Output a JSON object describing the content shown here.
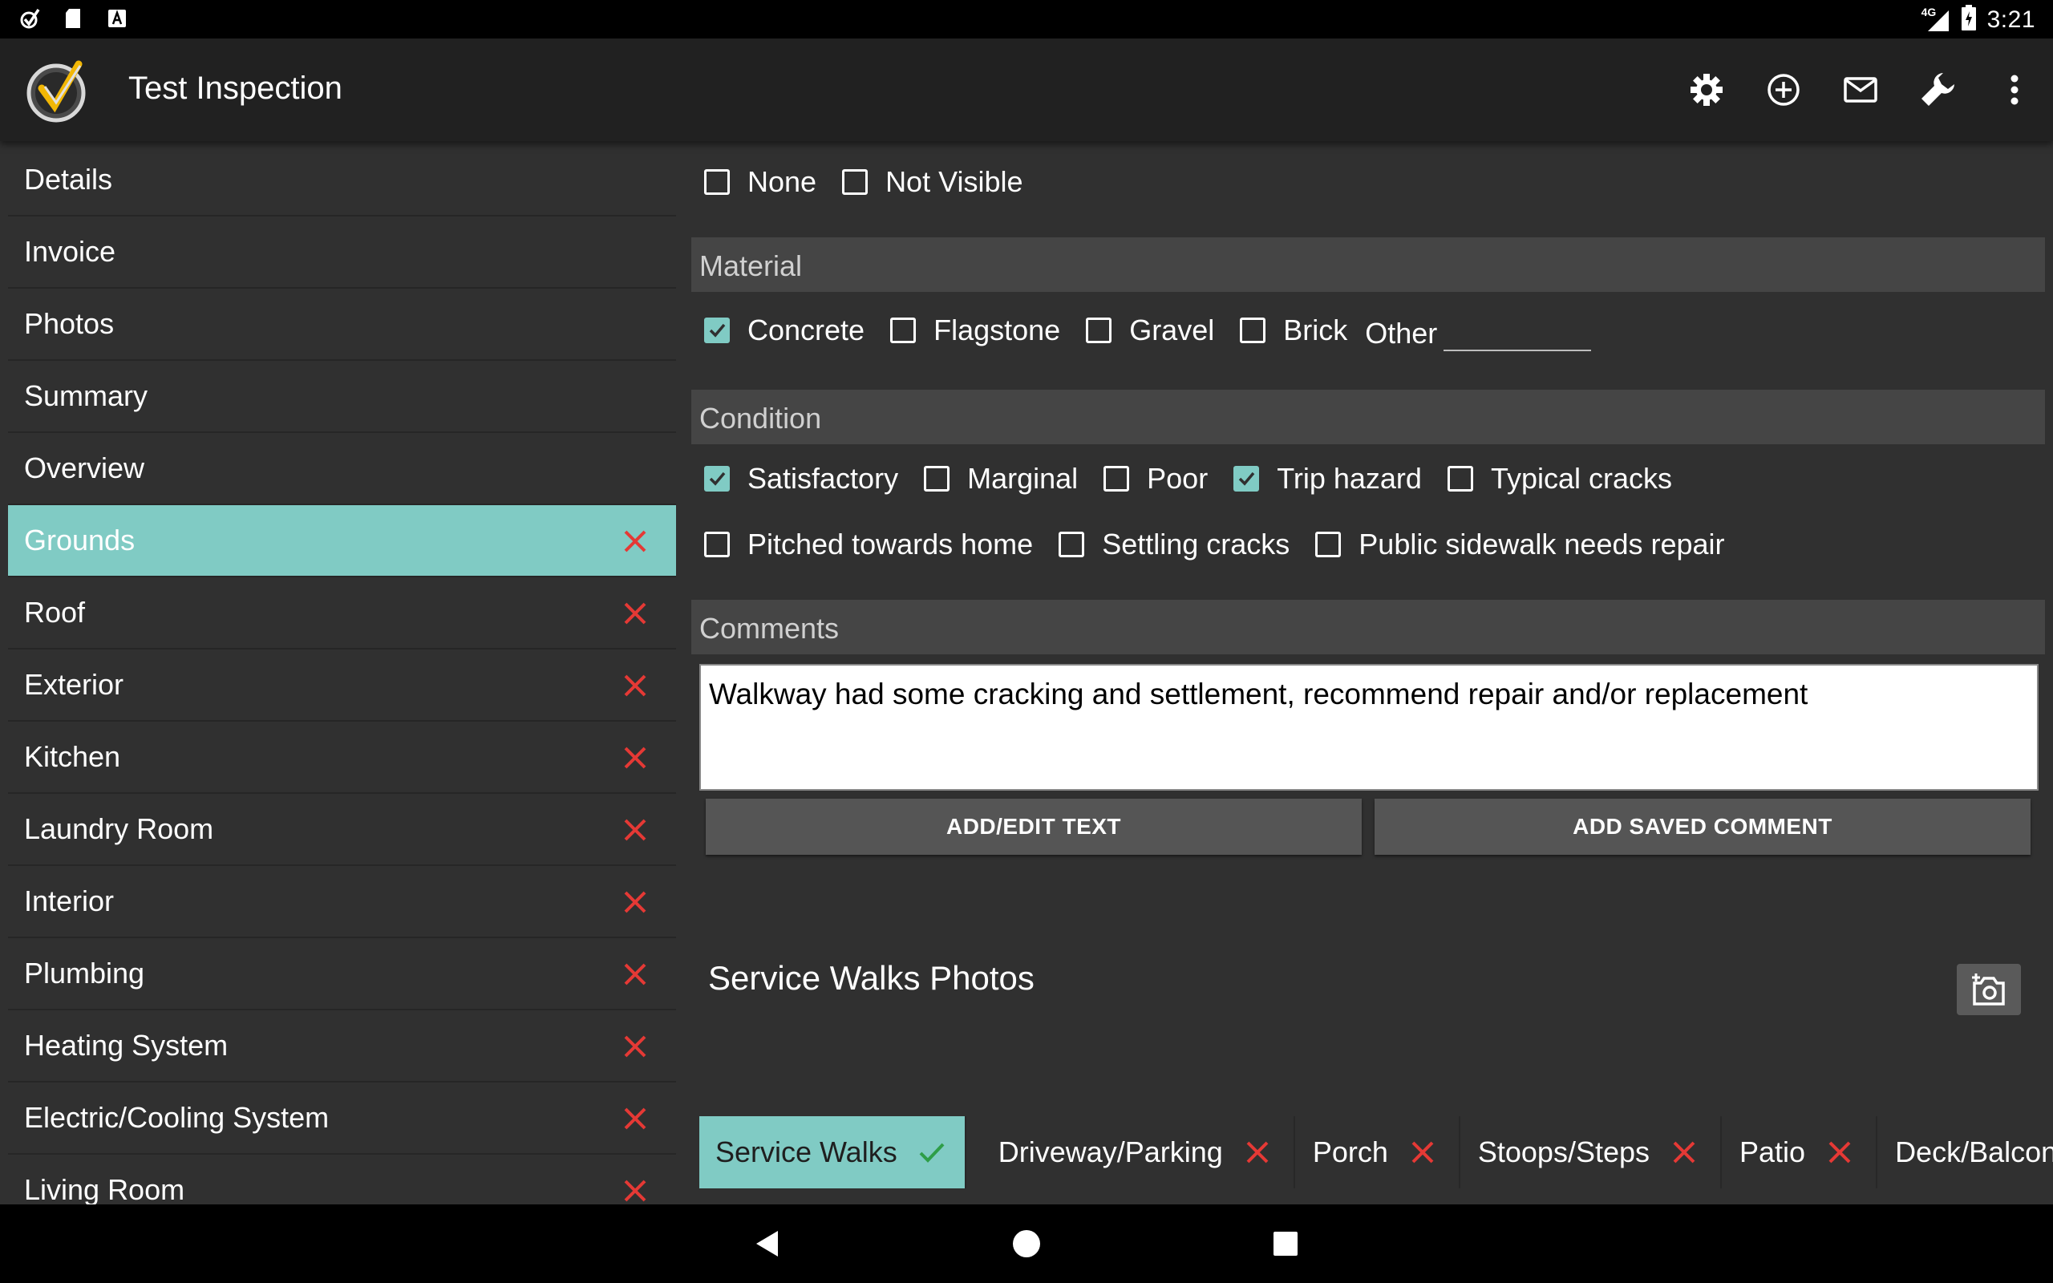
{
  "status_bar": {
    "time": "3:21",
    "network": "4G",
    "left_icons": [
      "app-check-icon",
      "sd-card-icon",
      "font-a-icon"
    ],
    "right_icons": [
      "signal-icon",
      "battery-icon"
    ]
  },
  "app_bar": {
    "title": "Test Inspection",
    "actions": [
      "settings-icon",
      "add-circle-icon",
      "mail-icon",
      "wrench-icon",
      "more-vert-icon"
    ]
  },
  "sidebar": {
    "items": [
      {
        "label": "Details",
        "status": "none"
      },
      {
        "label": "Invoice",
        "status": "none"
      },
      {
        "label": "Photos",
        "status": "none"
      },
      {
        "label": "Summary",
        "status": "none"
      },
      {
        "label": "Overview",
        "status": "none"
      },
      {
        "label": "Grounds",
        "status": "incomplete",
        "active": true
      },
      {
        "label": "Roof",
        "status": "incomplete"
      },
      {
        "label": "Exterior",
        "status": "incomplete"
      },
      {
        "label": "Kitchen",
        "status": "incomplete"
      },
      {
        "label": "Laundry Room",
        "status": "incomplete"
      },
      {
        "label": "Interior",
        "status": "incomplete"
      },
      {
        "label": "Plumbing",
        "status": "incomplete"
      },
      {
        "label": "Heating System",
        "status": "incomplete"
      },
      {
        "label": "Electric/Cooling System",
        "status": "incomplete"
      },
      {
        "label": "Living Room",
        "status": "incomplete"
      }
    ]
  },
  "main": {
    "top_options": [
      {
        "label": "None",
        "checked": false
      },
      {
        "label": "Not Visible",
        "checked": false
      }
    ],
    "material": {
      "heading": "Material",
      "options": [
        {
          "label": "Concrete",
          "checked": true
        },
        {
          "label": "Flagstone",
          "checked": false
        },
        {
          "label": "Gravel",
          "checked": false
        },
        {
          "label": "Brick",
          "checked": false
        }
      ],
      "other_label": "Other",
      "other_value": ""
    },
    "condition": {
      "heading": "Condition",
      "row1": [
        {
          "label": "Satisfactory",
          "checked": true
        },
        {
          "label": "Marginal",
          "checked": false
        },
        {
          "label": "Poor",
          "checked": false
        },
        {
          "label": "Trip hazard",
          "checked": true
        },
        {
          "label": "Typical cracks",
          "checked": false
        }
      ],
      "row2": [
        {
          "label": "Pitched towards home",
          "checked": false
        },
        {
          "label": "Settling cracks",
          "checked": false
        },
        {
          "label": "Public sidewalk needs repair",
          "checked": false
        }
      ]
    },
    "comments": {
      "heading": "Comments",
      "text": "Walkway had some cracking and settlement, recommend repair and/or replacement",
      "add_edit_label": "ADD/EDIT TEXT",
      "add_saved_label": "ADD SAVED COMMENT"
    },
    "photos": {
      "title": "Service Walks Photos",
      "camera_icon": "add-photo-icon"
    }
  },
  "tabs": [
    {
      "label": "Service Walks",
      "status": "complete",
      "active": true
    },
    {
      "label": "Driveway/Parking",
      "status": "incomplete"
    },
    {
      "label": "Porch",
      "status": "incomplete"
    },
    {
      "label": "Stoops/Steps",
      "status": "incomplete"
    },
    {
      "label": "Patio",
      "status": "incomplete"
    },
    {
      "label": "Deck/Balcony",
      "status": "incomplete"
    }
  ],
  "colors": {
    "accent": "#80cbc4",
    "error_x": "#e53935",
    "check_green": "#2e9e48",
    "background": "#303030",
    "app_bar": "#212121",
    "section_header": "#454545"
  },
  "nav_bar": [
    "back-icon",
    "home-icon",
    "recents-icon"
  ]
}
